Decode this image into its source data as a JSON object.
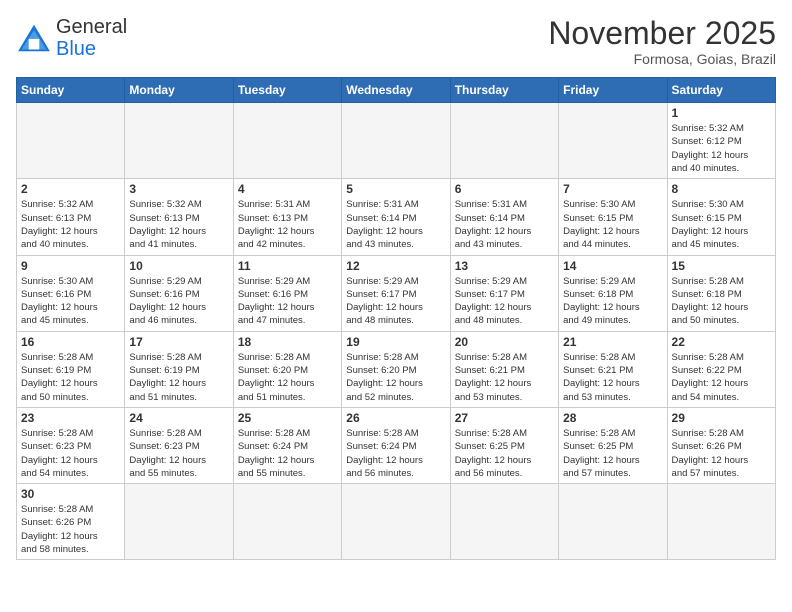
{
  "logo": {
    "line1": "General",
    "line2": "Blue"
  },
  "title": "November 2025",
  "subtitle": "Formosa, Goias, Brazil",
  "weekdays": [
    "Sunday",
    "Monday",
    "Tuesday",
    "Wednesday",
    "Thursday",
    "Friday",
    "Saturday"
  ],
  "days": [
    {
      "num": "",
      "info": ""
    },
    {
      "num": "",
      "info": ""
    },
    {
      "num": "",
      "info": ""
    },
    {
      "num": "",
      "info": ""
    },
    {
      "num": "",
      "info": ""
    },
    {
      "num": "",
      "info": ""
    },
    {
      "num": "1",
      "info": "Sunrise: 5:32 AM\nSunset: 6:12 PM\nDaylight: 12 hours\nand 40 minutes."
    },
    {
      "num": "2",
      "info": "Sunrise: 5:32 AM\nSunset: 6:13 PM\nDaylight: 12 hours\nand 40 minutes."
    },
    {
      "num": "3",
      "info": "Sunrise: 5:32 AM\nSunset: 6:13 PM\nDaylight: 12 hours\nand 41 minutes."
    },
    {
      "num": "4",
      "info": "Sunrise: 5:31 AM\nSunset: 6:13 PM\nDaylight: 12 hours\nand 42 minutes."
    },
    {
      "num": "5",
      "info": "Sunrise: 5:31 AM\nSunset: 6:14 PM\nDaylight: 12 hours\nand 43 minutes."
    },
    {
      "num": "6",
      "info": "Sunrise: 5:31 AM\nSunset: 6:14 PM\nDaylight: 12 hours\nand 43 minutes."
    },
    {
      "num": "7",
      "info": "Sunrise: 5:30 AM\nSunset: 6:15 PM\nDaylight: 12 hours\nand 44 minutes."
    },
    {
      "num": "8",
      "info": "Sunrise: 5:30 AM\nSunset: 6:15 PM\nDaylight: 12 hours\nand 45 minutes."
    },
    {
      "num": "9",
      "info": "Sunrise: 5:30 AM\nSunset: 6:16 PM\nDaylight: 12 hours\nand 45 minutes."
    },
    {
      "num": "10",
      "info": "Sunrise: 5:29 AM\nSunset: 6:16 PM\nDaylight: 12 hours\nand 46 minutes."
    },
    {
      "num": "11",
      "info": "Sunrise: 5:29 AM\nSunset: 6:16 PM\nDaylight: 12 hours\nand 47 minutes."
    },
    {
      "num": "12",
      "info": "Sunrise: 5:29 AM\nSunset: 6:17 PM\nDaylight: 12 hours\nand 48 minutes."
    },
    {
      "num": "13",
      "info": "Sunrise: 5:29 AM\nSunset: 6:17 PM\nDaylight: 12 hours\nand 48 minutes."
    },
    {
      "num": "14",
      "info": "Sunrise: 5:29 AM\nSunset: 6:18 PM\nDaylight: 12 hours\nand 49 minutes."
    },
    {
      "num": "15",
      "info": "Sunrise: 5:28 AM\nSunset: 6:18 PM\nDaylight: 12 hours\nand 50 minutes."
    },
    {
      "num": "16",
      "info": "Sunrise: 5:28 AM\nSunset: 6:19 PM\nDaylight: 12 hours\nand 50 minutes."
    },
    {
      "num": "17",
      "info": "Sunrise: 5:28 AM\nSunset: 6:19 PM\nDaylight: 12 hours\nand 51 minutes."
    },
    {
      "num": "18",
      "info": "Sunrise: 5:28 AM\nSunset: 6:20 PM\nDaylight: 12 hours\nand 51 minutes."
    },
    {
      "num": "19",
      "info": "Sunrise: 5:28 AM\nSunset: 6:20 PM\nDaylight: 12 hours\nand 52 minutes."
    },
    {
      "num": "20",
      "info": "Sunrise: 5:28 AM\nSunset: 6:21 PM\nDaylight: 12 hours\nand 53 minutes."
    },
    {
      "num": "21",
      "info": "Sunrise: 5:28 AM\nSunset: 6:21 PM\nDaylight: 12 hours\nand 53 minutes."
    },
    {
      "num": "22",
      "info": "Sunrise: 5:28 AM\nSunset: 6:22 PM\nDaylight: 12 hours\nand 54 minutes."
    },
    {
      "num": "23",
      "info": "Sunrise: 5:28 AM\nSunset: 6:23 PM\nDaylight: 12 hours\nand 54 minutes."
    },
    {
      "num": "24",
      "info": "Sunrise: 5:28 AM\nSunset: 6:23 PM\nDaylight: 12 hours\nand 55 minutes."
    },
    {
      "num": "25",
      "info": "Sunrise: 5:28 AM\nSunset: 6:24 PM\nDaylight: 12 hours\nand 55 minutes."
    },
    {
      "num": "26",
      "info": "Sunrise: 5:28 AM\nSunset: 6:24 PM\nDaylight: 12 hours\nand 56 minutes."
    },
    {
      "num": "27",
      "info": "Sunrise: 5:28 AM\nSunset: 6:25 PM\nDaylight: 12 hours\nand 56 minutes."
    },
    {
      "num": "28",
      "info": "Sunrise: 5:28 AM\nSunset: 6:25 PM\nDaylight: 12 hours\nand 57 minutes."
    },
    {
      "num": "29",
      "info": "Sunrise: 5:28 AM\nSunset: 6:26 PM\nDaylight: 12 hours\nand 57 minutes."
    },
    {
      "num": "30",
      "info": "Sunrise: 5:28 AM\nSunset: 6:26 PM\nDaylight: 12 hours\nand 58 minutes."
    },
    {
      "num": "",
      "info": ""
    },
    {
      "num": "",
      "info": ""
    },
    {
      "num": "",
      "info": ""
    },
    {
      "num": "",
      "info": ""
    },
    {
      "num": "",
      "info": ""
    },
    {
      "num": "",
      "info": ""
    }
  ]
}
